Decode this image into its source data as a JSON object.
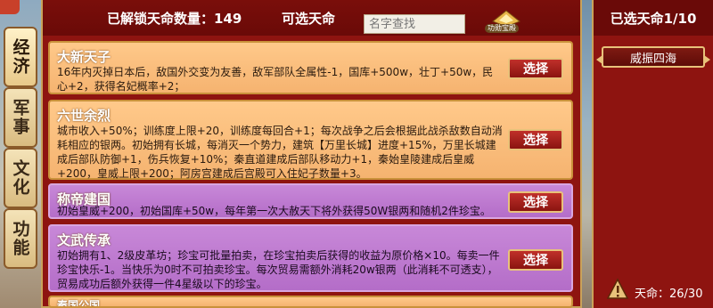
{
  "side_tabs": [
    {
      "label": "经济",
      "active": true
    },
    {
      "label": "军事",
      "active": false
    },
    {
      "label": "文化",
      "active": false
    },
    {
      "label": "功能",
      "active": false
    }
  ],
  "header": {
    "unlocked_count_text": "已解锁天命数量：149",
    "selectable_label": "可选天命",
    "search_placeholder": "名字查找",
    "emblem_label": "功勋宝殿"
  },
  "cards": [
    {
      "title": "大新天子",
      "style": "orange",
      "desc": "16年内灭掉日本后，敌国外交变为友善，敌军部队全属性-1，国库+500w，壮丁+50w，民心+2，获得名妃概率+2；",
      "button": "选择"
    },
    {
      "title": "六世余烈",
      "style": "orange",
      "desc": "城市收入+50%；训练度上限+20，训练度每回合+1；每次战争之后会根据此战杀敌数自动消耗相应的银两。初始拥有长城，每消灭一个势力，建筑【万里长城】进度+15%，万里长城建成后部队防御+1，伤兵恢复+10%；秦直道建成后部队移动力+1，秦始皇陵建成后皇威+200，皇威上限+200；阿房宫建成后宫殿可入住妃子数量+3。",
      "button": "选择"
    },
    {
      "title": "称帝建国",
      "style": "purple",
      "desc": "初始皇威+200，初始国库+50w，每年第一次大赦天下将外获得50W银两和随机2件珍宝。",
      "button": "选择"
    },
    {
      "title": "文武传承",
      "style": "purple",
      "desc": "初始拥有1、2级皮革坊；珍宝可批量拍卖，在珍宝拍卖后获得的收益为原价格×10。每卖一件珍宝快乐-1。当快乐为0时不可拍卖珍宝。每次贸易需额外消耗20w银两（此消耗不可透支），贸易成功后额外获得一件4星级以下的珍宝。",
      "button": "选择"
    },
    {
      "title": "秦国公国",
      "style": "orange",
      "desc": "",
      "button": ""
    }
  ],
  "right_panel": {
    "title": "已选天命1/10",
    "chosen": [
      "威振四海"
    ],
    "stat_text": "天命：26/30"
  },
  "colors": {
    "panel_red": "#8e1410",
    "gold_border": "#c9a25a",
    "button_red": "#a8201a"
  }
}
